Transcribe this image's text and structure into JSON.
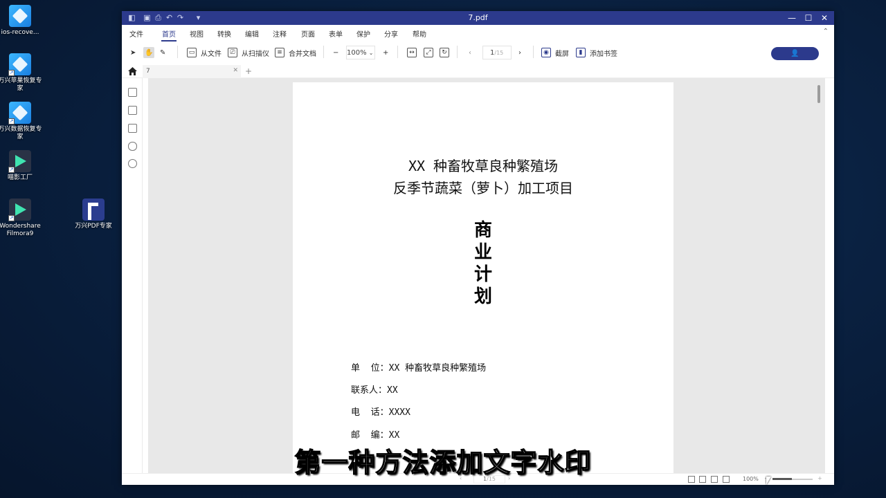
{
  "desktop": {
    "icons": [
      {
        "label": "ios-recove...",
        "icon": "recovery-app-icon"
      },
      {
        "label": "万兴苹果恢复专家",
        "icon": "recovery-app-icon"
      },
      {
        "label": "万兴数据恢复专家",
        "icon": "recovery-app-icon"
      },
      {
        "label": "喵影工厂",
        "icon": "filmora-icon"
      },
      {
        "label": "Wondershare Filmora9",
        "icon": "filmora-icon"
      },
      {
        "label": "万兴PDF专家",
        "icon": "pdf-app-icon"
      }
    ]
  },
  "window": {
    "title": "7.pdf",
    "menu": [
      "文件",
      "首页",
      "视图",
      "转换",
      "编辑",
      "注释",
      "页面",
      "表单",
      "保护",
      "分享",
      "帮助"
    ],
    "active_menu": "首页",
    "toolbar": {
      "from_file": "从文件",
      "from_scanner": "从扫描仪",
      "merge": "合并文档",
      "zoom": "100%",
      "page_current": "1",
      "page_total": "/15",
      "screenshot": "截屏",
      "add_bookmark": "添加书签"
    },
    "tab": {
      "name": "7"
    },
    "document": {
      "title_line1": "XX 种畜牧草良种繁殖场",
      "title_line2": "反季节蔬菜（萝卜）加工项目",
      "vertical_title": [
        "商",
        "业",
        "计",
        "划"
      ],
      "info": [
        "单  位：XX 种畜牧草良种繁殖场",
        "联系人：XX",
        "电  话：XXXX",
        "邮  编：XX"
      ]
    },
    "status": {
      "page_current": "1",
      "page_total": "/15",
      "zoom": "100%"
    }
  },
  "subtitle": "第一种方法添加文字水印"
}
